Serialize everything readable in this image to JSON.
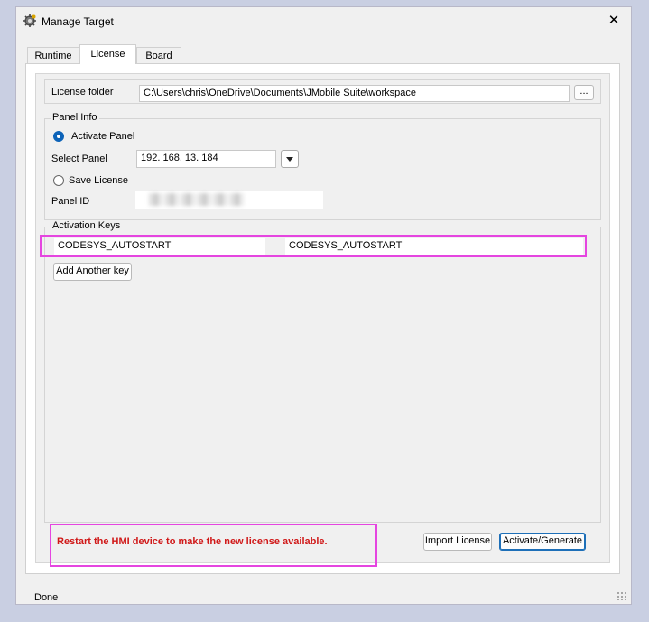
{
  "window": {
    "title": "Manage Target",
    "close_label": "✕"
  },
  "tabs": [
    {
      "label": "Runtime",
      "active": false
    },
    {
      "label": "License",
      "active": true
    },
    {
      "label": "Board",
      "active": false
    }
  ],
  "license_folder": {
    "label": "License folder",
    "value": "C:\\Users\\chris\\OneDrive\\Documents\\JMobile Suite\\workspace",
    "browse_label": "..."
  },
  "panel_info": {
    "legend": "Panel Info",
    "activate_label": "Activate Panel",
    "activate_selected": true,
    "select_panel_label": "Select Panel",
    "select_panel_value": "192. 168. 13. 184",
    "save_label": "Save License",
    "save_selected": false,
    "panel_id_label": "Panel ID"
  },
  "activation_keys": {
    "legend": "Activation Keys",
    "key1": "CODESYS_AUTOSTART",
    "key2": "CODESYS_AUTOSTART",
    "add_label": "Add Another key"
  },
  "footer": {
    "message": "Restart the HMI device to make the new license available.",
    "import_label": "Import License",
    "activate_label": "Activate/Generate"
  },
  "status": {
    "text": "Done"
  },
  "colors": {
    "warning": "#d01818",
    "highlight": "#e545e0",
    "accent": "#0c63b8"
  }
}
